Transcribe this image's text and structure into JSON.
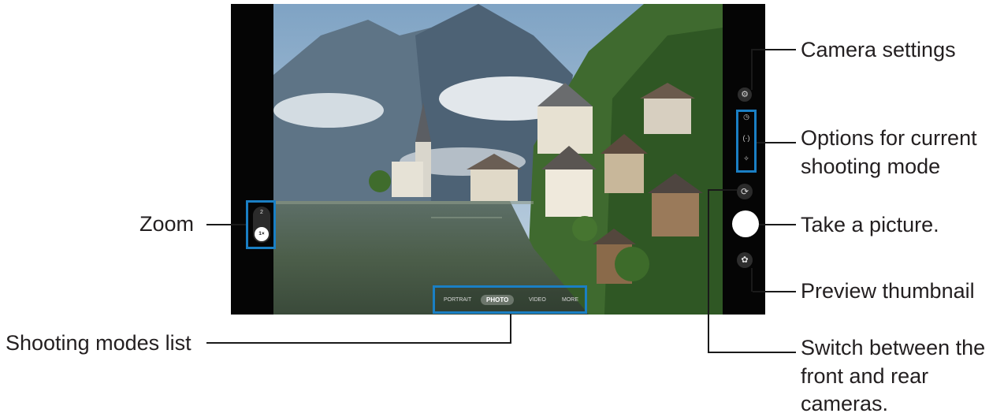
{
  "zoom": {
    "level_top": "2",
    "level_selected": "1×"
  },
  "modes": {
    "portrait": "PORTRAIT",
    "photo": "PHOTO",
    "video": "VIDEO",
    "more": "MORE"
  },
  "icons": {
    "settings": "gear-icon",
    "timer": "timer-icon",
    "aspect": "aspect-ratio-icon",
    "effects": "magic-wand-icon",
    "switch": "switch-camera-icon",
    "thumbnail": "flower-icon"
  },
  "callouts": {
    "camera_settings": "Camera settings",
    "options_line1": "Options for current",
    "options_line2": "shooting mode",
    "take_picture": "Take a picture.",
    "preview_thumbnail": "Preview thumbnail",
    "switch_line1": "Switch between the",
    "switch_line2": "front and rear",
    "switch_line3": "cameras.",
    "zoom": "Zoom",
    "shooting_modes": "Shooting modes list"
  },
  "colors": {
    "highlight": "#1a7fc4",
    "bezel": "#050505"
  }
}
